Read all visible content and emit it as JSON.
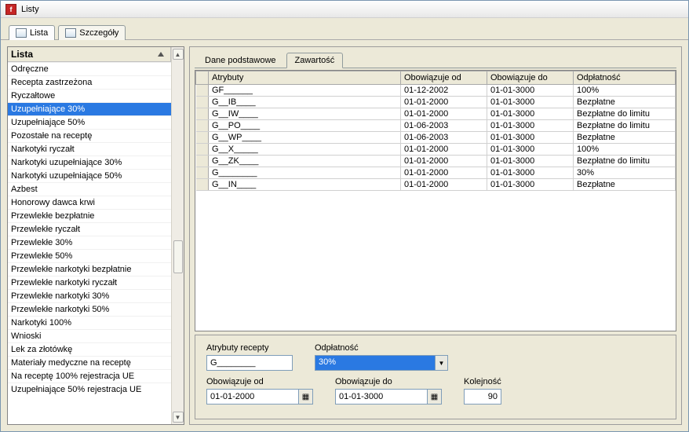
{
  "window": {
    "title": "Listy"
  },
  "top_tabs": [
    {
      "label": "Lista",
      "active": true
    },
    {
      "label": "Szczegóły",
      "active": false
    }
  ],
  "list": {
    "header": "Lista",
    "items": [
      "Odręczne",
      "Recepta zastrzeżona",
      "Ryczałtowe",
      "Uzupełniające 30%",
      "Uzupełniające 50%",
      "Pozostałe na receptę",
      "Narkotyki ryczałt",
      "Narkotyki uzupełniające 30%",
      "Narkotyki uzupełniające 50%",
      "Azbest",
      "Honorowy dawca krwi",
      "Przewlekłe bezpłatnie",
      "Przewlekłe ryczałt",
      "Przewlekłe 30%",
      "Przewlekłe 50%",
      "Przewlekłe narkotyki bezpłatnie",
      "Przewlekłe narkotyki ryczałt",
      "Przewlekłe narkotyki 30%",
      "Przewlekłe narkotyki 50%",
      "Narkotyki 100%",
      "Wnioski",
      "Lek za złotówkę",
      "Materiały medyczne na receptę",
      "Na receptę 100% rejestracja UE",
      "Uzupełniające 50% rejestracja UE"
    ],
    "selected_index": 3
  },
  "subtabs": [
    {
      "label": "Dane podstawowe",
      "active": false
    },
    {
      "label": "Zawartość",
      "active": true
    }
  ],
  "table": {
    "columns": [
      "Atrybuty",
      "Obowiązuje od",
      "Obowiązuje do",
      "Odpłatność"
    ],
    "rows": [
      {
        "cells": [
          "GF______",
          "01-12-2002",
          "01-01-3000",
          "100%"
        ]
      },
      {
        "cells": [
          "G__IB____",
          "01-01-2000",
          "01-01-3000",
          "Bezpłatne"
        ]
      },
      {
        "cells": [
          "G__IW____",
          "01-01-2000",
          "01-01-3000",
          "Bezpłatne do limitu"
        ]
      },
      {
        "cells": [
          "G__PO____",
          "01-06-2003",
          "01-01-3000",
          "Bezpłatne do limitu"
        ]
      },
      {
        "cells": [
          "G__WP____",
          "01-06-2003",
          "01-01-3000",
          "Bezpłatne"
        ]
      },
      {
        "cells": [
          "G__X_____",
          "01-01-2000",
          "01-01-3000",
          "100%"
        ]
      },
      {
        "cells": [
          "G__ZK____",
          "01-01-2000",
          "01-01-3000",
          "Bezpłatne do limitu"
        ]
      },
      {
        "cells": [
          "G________",
          "01-01-2000",
          "01-01-3000",
          "30%"
        ],
        "editing": true
      },
      {
        "cells": [
          "G__IN____",
          "01-01-2000",
          "01-01-3000",
          "Bezpłatne"
        ]
      }
    ]
  },
  "form": {
    "atrybuty_label": "Atrybuty recepty",
    "atrybuty_value": "G________",
    "odplatnosc_label": "Odpłatność",
    "odplatnosc_value": "30%",
    "obow_od_label": "Obowiązuje od",
    "obow_od_value": "01-01-2000",
    "obow_do_label": "Obowiązuje do",
    "obow_do_value": "01-01-3000",
    "kolejnosc_label": "Kolejność",
    "kolejnosc_value": "90"
  }
}
